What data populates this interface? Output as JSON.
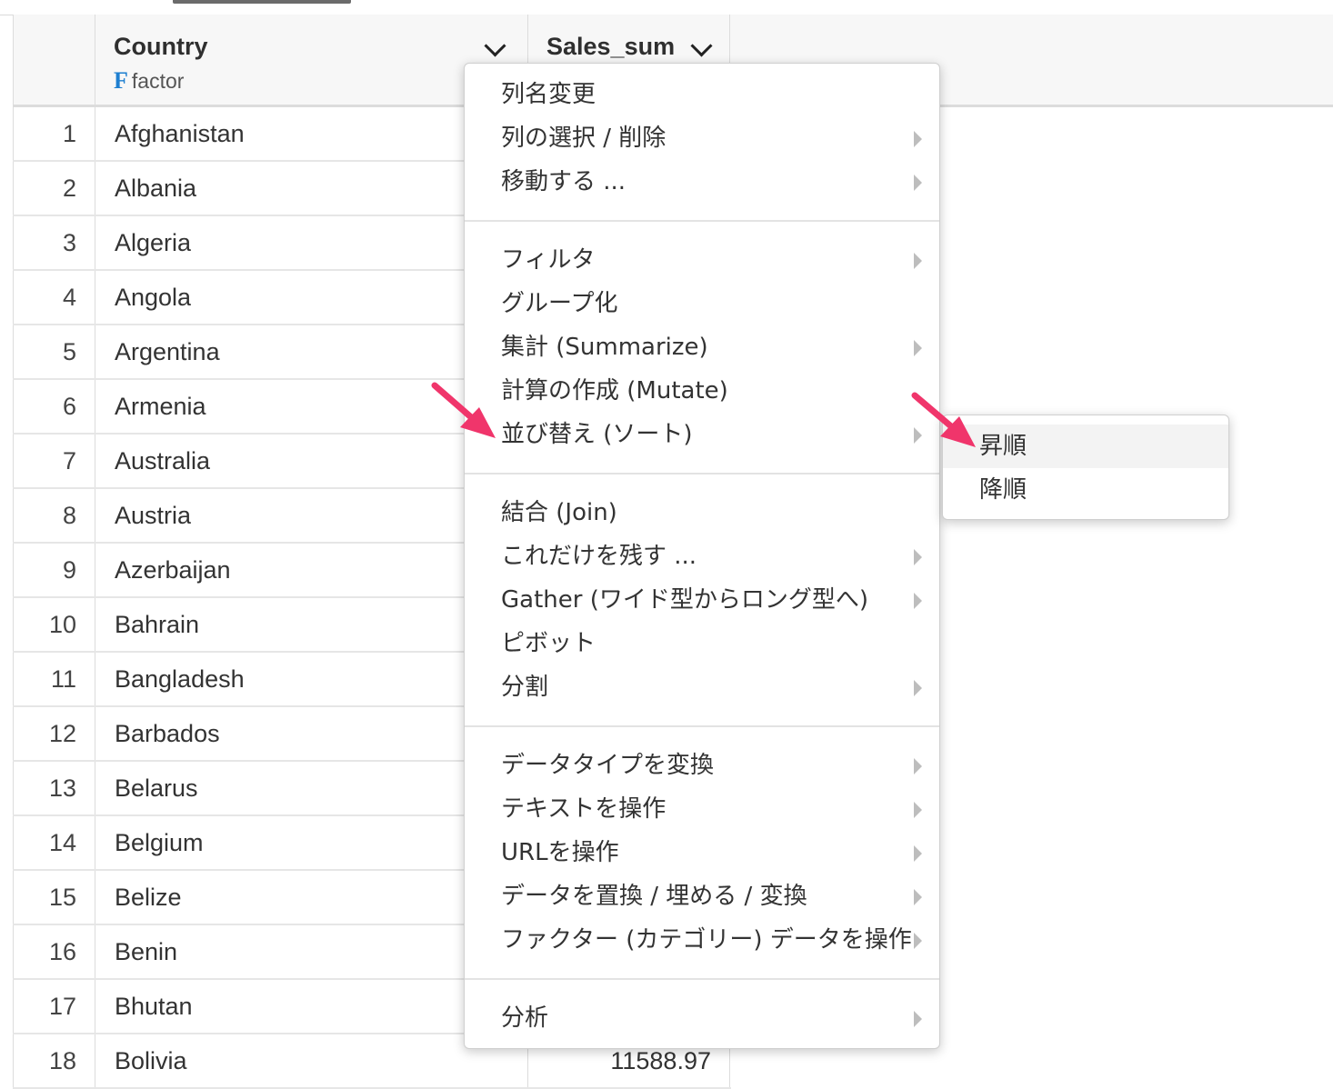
{
  "table": {
    "columns": [
      {
        "name": "Country",
        "type_label": "factor",
        "type_icon": "F"
      },
      {
        "name": "Sales_sum"
      }
    ],
    "rows": [
      {
        "index": "1",
        "country": "Afghanistan"
      },
      {
        "index": "2",
        "country": "Albania"
      },
      {
        "index": "3",
        "country": "Algeria"
      },
      {
        "index": "4",
        "country": "Angola"
      },
      {
        "index": "5",
        "country": "Argentina"
      },
      {
        "index": "6",
        "country": "Armenia"
      },
      {
        "index": "7",
        "country": "Australia"
      },
      {
        "index": "8",
        "country": "Austria"
      },
      {
        "index": "9",
        "country": "Azerbaijan"
      },
      {
        "index": "10",
        "country": "Bahrain"
      },
      {
        "index": "11",
        "country": "Bangladesh"
      },
      {
        "index": "12",
        "country": "Barbados"
      },
      {
        "index": "13",
        "country": "Belarus"
      },
      {
        "index": "14",
        "country": "Belgium"
      },
      {
        "index": "15",
        "country": "Belize"
      },
      {
        "index": "16",
        "country": "Benin"
      },
      {
        "index": "17",
        "country": "Bhutan"
      },
      {
        "index": "18",
        "country": "Bolivia",
        "sales": "11588.97"
      }
    ]
  },
  "menu": {
    "items": [
      {
        "label": "列名変更",
        "submenu": false
      },
      {
        "label": "列の選択 / 削除",
        "submenu": true
      },
      {
        "label": "移動する ...",
        "submenu": true
      },
      {
        "label": "フィルタ",
        "submenu": true
      },
      {
        "label": "グループ化",
        "submenu": false
      },
      {
        "label": "集計 (Summarize)",
        "submenu": true
      },
      {
        "label": "計算の作成 (Mutate)",
        "submenu": false
      },
      {
        "label": "並び替え (ソート)",
        "submenu": true
      },
      {
        "label": "結合 (Join)",
        "submenu": false
      },
      {
        "label": "これだけを残す ...",
        "submenu": true
      },
      {
        "label": "Gather (ワイド型からロング型へ)",
        "submenu": true
      },
      {
        "label": "ピボット",
        "submenu": false
      },
      {
        "label": "分割",
        "submenu": true
      },
      {
        "label": "データタイプを変換",
        "submenu": true
      },
      {
        "label": "テキストを操作",
        "submenu": true
      },
      {
        "label": "URLを操作",
        "submenu": true
      },
      {
        "label": "データを置換 / 埋める / 変換",
        "submenu": true
      },
      {
        "label": "ファクター (カテゴリー) データを操作",
        "submenu": true
      },
      {
        "label": "分析",
        "submenu": true
      }
    ]
  },
  "submenu": {
    "items": [
      {
        "label": "昇順",
        "highlighted": true
      },
      {
        "label": "降順",
        "highlighted": false
      }
    ]
  },
  "colors": {
    "annotation_arrow": "#f0356b",
    "type_icon": "#1e7fd0"
  }
}
